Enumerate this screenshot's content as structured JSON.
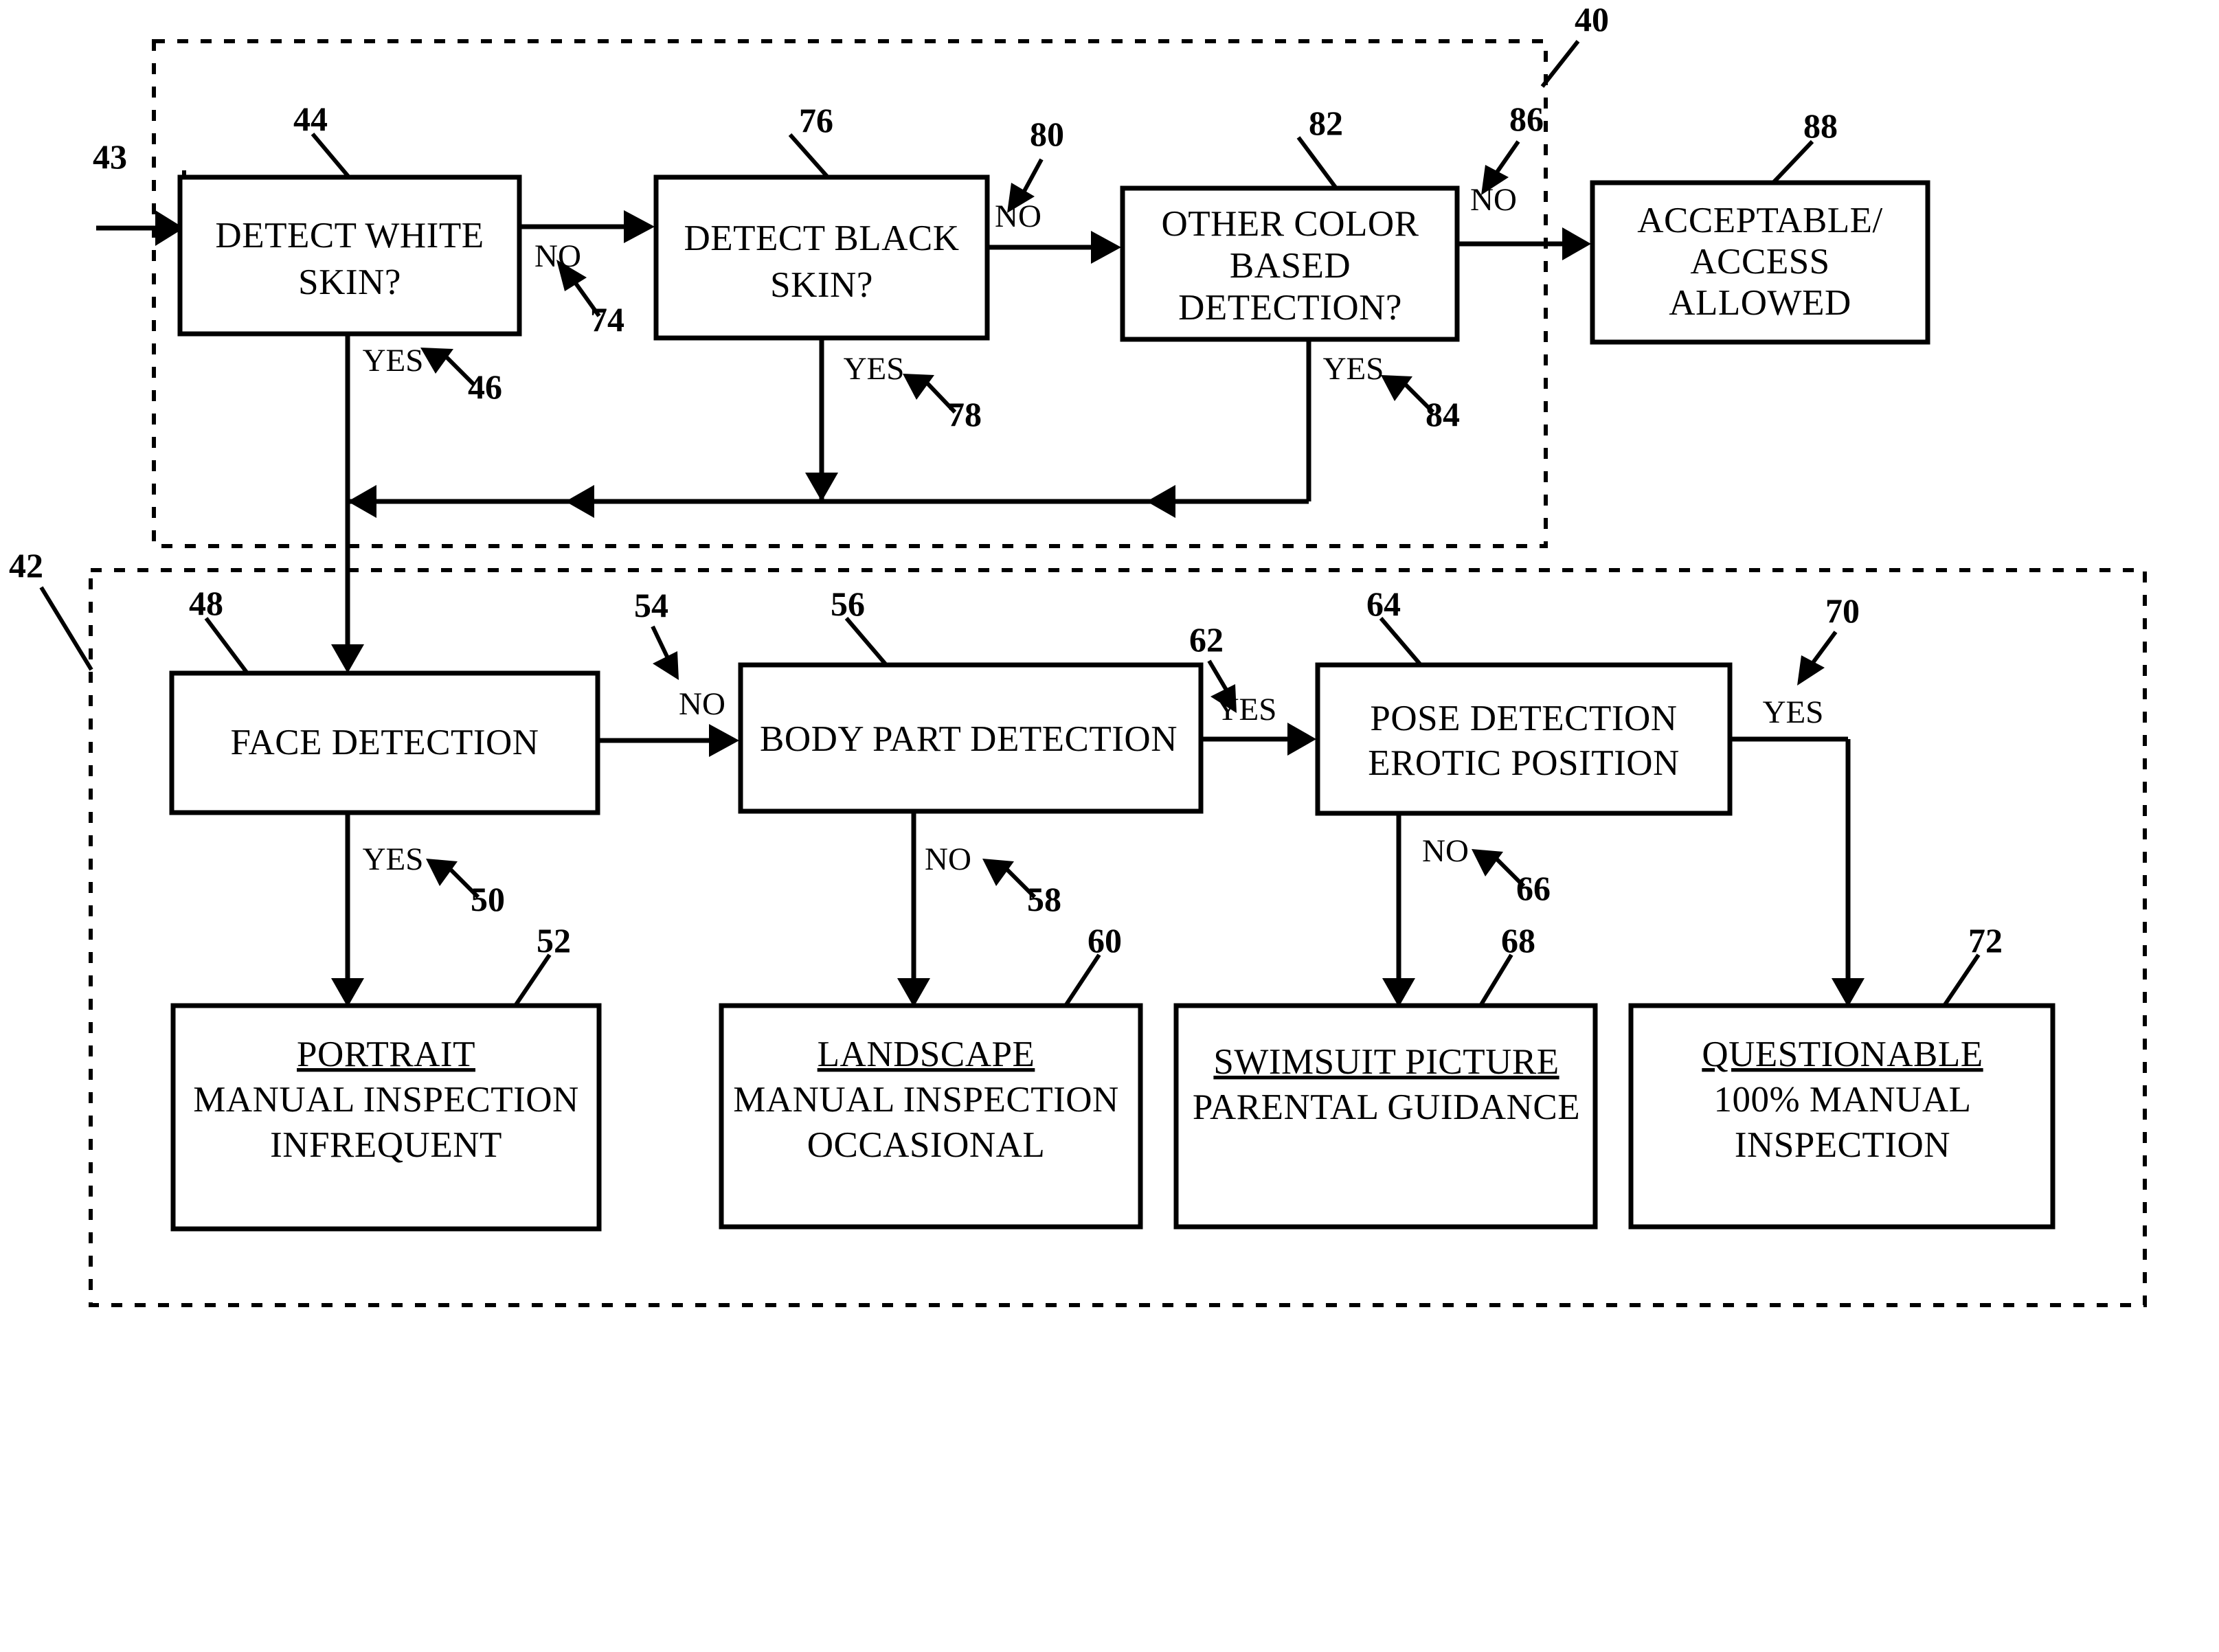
{
  "figure": {
    "regions": [
      {
        "id": "region-40",
        "ref": "40"
      },
      {
        "id": "region-42",
        "ref": "42"
      }
    ],
    "entry": {
      "ref": "43"
    },
    "boxes": [
      {
        "id": "detect-white-skin",
        "ref": "44",
        "lines": [
          "DETECT WHITE",
          "SKIN?"
        ],
        "underline_first": false
      },
      {
        "id": "detect-black-skin",
        "ref": "76",
        "lines": [
          "DETECT BLACK",
          "SKIN?"
        ],
        "underline_first": false
      },
      {
        "id": "other-color-based-detection",
        "ref": "82",
        "lines": [
          "OTHER COLOR",
          "BASED",
          "DETECTION?"
        ],
        "underline_first": false
      },
      {
        "id": "acceptable-access-allowed",
        "ref": "88",
        "lines": [
          "ACCEPTABLE/",
          "ACCESS",
          "ALLOWED"
        ],
        "underline_first": false
      },
      {
        "id": "face-detection",
        "ref": "48",
        "lines": [
          "FACE DETECTION"
        ],
        "underline_first": false
      },
      {
        "id": "body-part-detection",
        "ref": "56",
        "lines": [
          "BODY PART DETECTION"
        ],
        "underline_first": false
      },
      {
        "id": "pose-detection-erotic-position",
        "ref": "64",
        "lines": [
          "POSE DETECTION",
          "EROTIC POSITION"
        ],
        "underline_first": false
      },
      {
        "id": "portrait-outcome",
        "ref": "52",
        "lines": [
          "PORTRAIT",
          "MANUAL INSPECTION",
          "INFREQUENT"
        ],
        "underline_first": true
      },
      {
        "id": "landscape-outcome",
        "ref": "60",
        "lines": [
          "LANDSCAPE",
          "MANUAL INSPECTION",
          "OCCASIONAL"
        ],
        "underline_first": true
      },
      {
        "id": "swimsuit-outcome",
        "ref": "68",
        "lines": [
          "SWIMSUIT PICTURE",
          "PARENTAL GUIDANCE"
        ],
        "underline_first": true
      },
      {
        "id": "questionable-outcome",
        "ref": "72",
        "lines": [
          "QUESTIONABLE",
          "100% MANUAL",
          "INSPECTION"
        ],
        "underline_first": true
      }
    ],
    "branches": [
      {
        "id": "white-skin-no",
        "label": "NO",
        "ref": "74"
      },
      {
        "id": "white-skin-yes",
        "label": "YES",
        "ref": "46"
      },
      {
        "id": "black-skin-no",
        "label": "NO",
        "ref": "80"
      },
      {
        "id": "black-skin-yes",
        "label": "YES",
        "ref": "78"
      },
      {
        "id": "other-color-no",
        "label": "NO",
        "ref": "86"
      },
      {
        "id": "other-color-yes",
        "label": "YES",
        "ref": "84"
      },
      {
        "id": "face-detection-yes",
        "label": "YES",
        "ref": "50"
      },
      {
        "id": "face-detection-no",
        "label": "NO",
        "ref": "54"
      },
      {
        "id": "body-part-no",
        "label": "NO",
        "ref": "58"
      },
      {
        "id": "body-part-yes",
        "label": "YES",
        "ref": "62"
      },
      {
        "id": "pose-no",
        "label": "NO",
        "ref": "66"
      },
      {
        "id": "pose-yes",
        "label": "YES",
        "ref": "70"
      }
    ]
  }
}
